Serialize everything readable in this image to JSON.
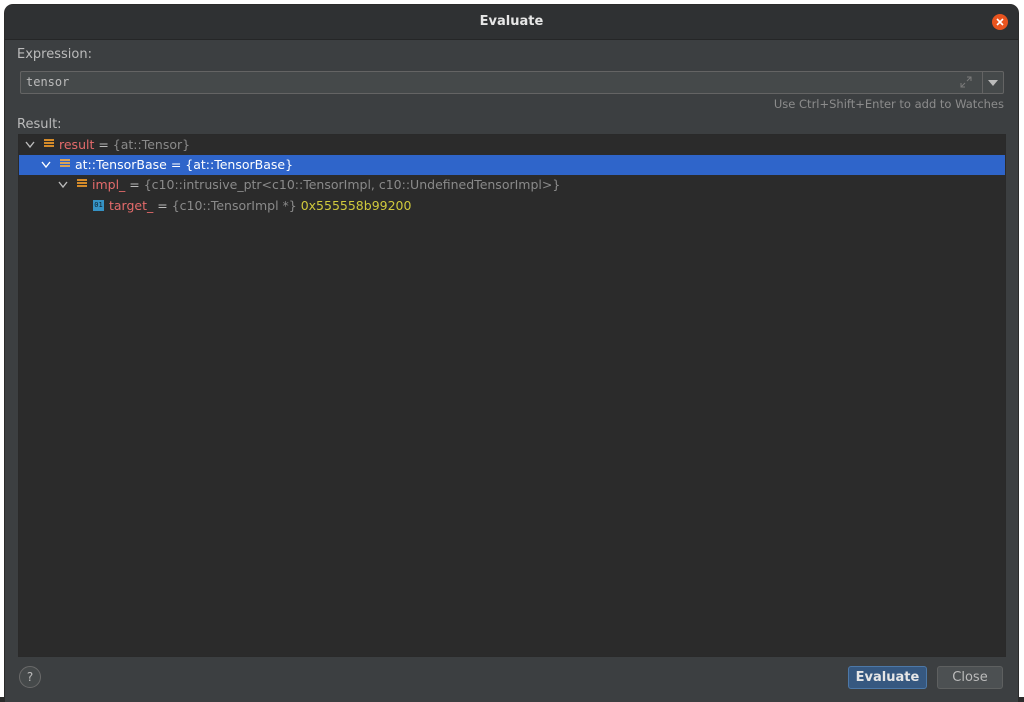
{
  "window": {
    "title": "Evaluate"
  },
  "expression": {
    "label": "Expression:",
    "value": "tensor",
    "hint": "Use Ctrl+Shift+Enter to add to Watches"
  },
  "result": {
    "label": "Result:",
    "rows": [
      {
        "name": "result",
        "eq": " = ",
        "type": "{at::Tensor}",
        "value": "",
        "selected": false,
        "expanded": true
      },
      {
        "name": "at::TensorBase",
        "eq": " = ",
        "type": "{at::TensorBase}",
        "value": "",
        "selected": true,
        "expanded": true
      },
      {
        "name": "impl_",
        "eq": " = ",
        "type": "{c10::intrusive_ptr<c10::TensorImpl, c10::UndefinedTensorImpl>}",
        "value": "",
        "selected": false,
        "expanded": true
      },
      {
        "name": "target_",
        "eq": " = ",
        "type": "{c10::TensorImpl *}",
        "value": " 0x555558b99200",
        "selected": false,
        "expanded": false,
        "icon_text": "01"
      }
    ]
  },
  "buttons": {
    "help": "?",
    "evaluate": "Evaluate",
    "close": "Close"
  },
  "colors": {
    "dialog_bg": "#3c3f41",
    "tree_bg": "#2b2b2b",
    "selection": "#2f65ca",
    "name_color": "#e56b6b",
    "value_color": "#d0c93c",
    "close_circle": "#e9541f"
  }
}
